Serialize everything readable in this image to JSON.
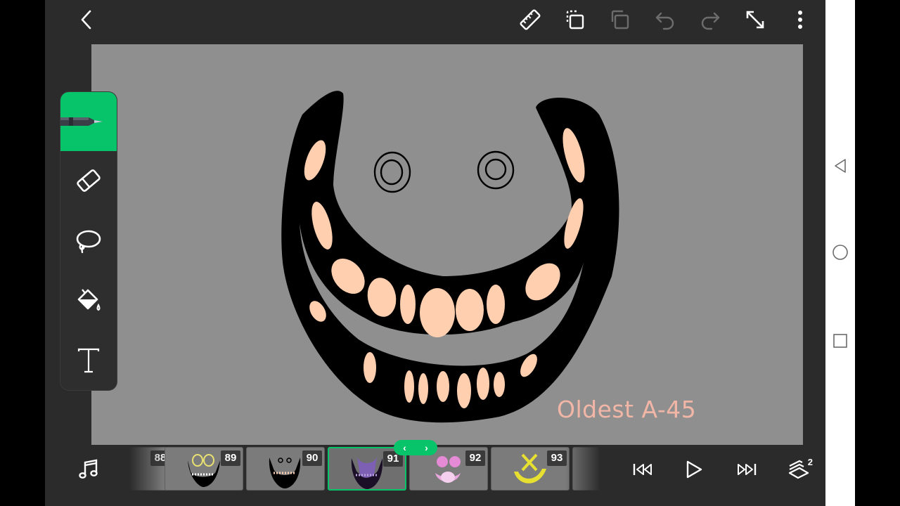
{
  "canvas": {
    "background_color": "#8f8f90",
    "watermark": "Oldest A-45"
  },
  "toolbar": {
    "icons": [
      "back-icon",
      "ruler-icon",
      "copy-frame-icon",
      "paste-frame-icon",
      "undo-icon",
      "redo-icon",
      "fullscreen-icon",
      "more-icon"
    ]
  },
  "tools": {
    "active": "pen",
    "items": [
      "pen",
      "eraser",
      "lasso",
      "fill",
      "text"
    ],
    "active_color": "#07c36a"
  },
  "timeline": {
    "frames": [
      {
        "number": "88"
      },
      {
        "number": "89"
      },
      {
        "number": "90"
      },
      {
        "number": "91"
      },
      {
        "number": "92"
      },
      {
        "number": "93"
      }
    ],
    "selected_frame": "91",
    "layers_count": "2"
  },
  "colors": {
    "accent": "#07c36a",
    "ink": "#000000",
    "teeth": "#ffcfb0"
  }
}
